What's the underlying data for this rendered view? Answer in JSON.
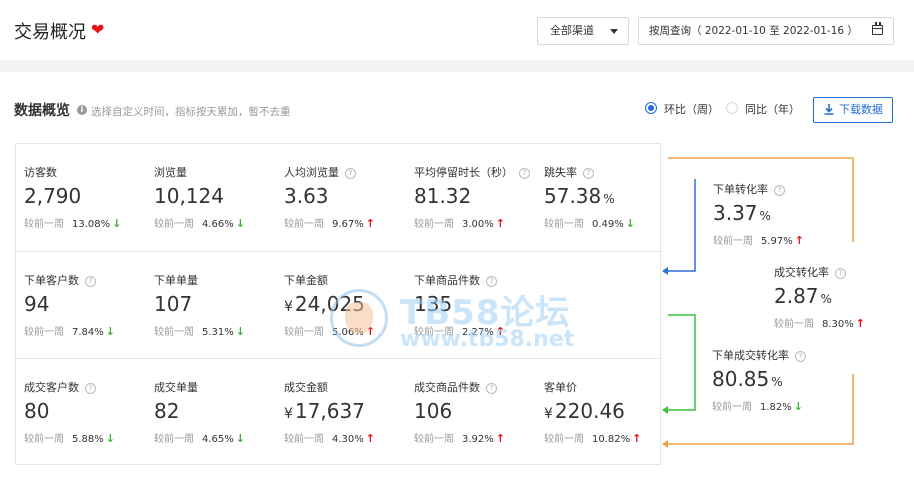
{
  "header": {
    "title": "交易概况",
    "channel": {
      "selected": "全部渠道"
    },
    "date_range": {
      "text": "按周查询（ 2022-01-10 至 2022-01-16 ）"
    }
  },
  "overview": {
    "title": "数据概览",
    "hint": "选择自定义时间，指标按天累加，暂不去重",
    "compare": {
      "options": [
        {
          "label": "环比（周）",
          "selected": true
        },
        {
          "label": "同比（年）",
          "selected": false
        }
      ]
    },
    "download_label": "下载数据",
    "compare_label": "较前一周",
    "rows": [
      [
        {
          "label": "访客数",
          "help": false,
          "prefix": "",
          "value": "2,790",
          "suffix": "",
          "rate": "13.08%",
          "trend": "down"
        },
        {
          "label": "浏览量",
          "help": false,
          "prefix": "",
          "value": "10,124",
          "suffix": "",
          "rate": "4.66%",
          "trend": "down"
        },
        {
          "label": "人均浏览量",
          "help": true,
          "prefix": "",
          "value": "3.63",
          "suffix": "",
          "rate": "9.67%",
          "trend": "up"
        },
        {
          "label": "平均停留时长（秒）",
          "help": true,
          "prefix": "",
          "value": "81.32",
          "suffix": "",
          "rate": "3.00%",
          "trend": "up"
        },
        {
          "label": "跳失率",
          "help": true,
          "prefix": "",
          "value": "57.38",
          "suffix": "%",
          "rate": "0.49%",
          "trend": "down"
        }
      ],
      [
        {
          "label": "下单客户数",
          "help": true,
          "prefix": "",
          "value": "94",
          "suffix": "",
          "rate": "7.84%",
          "trend": "down"
        },
        {
          "label": "下单单量",
          "help": false,
          "prefix": "",
          "value": "107",
          "suffix": "",
          "rate": "5.31%",
          "trend": "down"
        },
        {
          "label": "下单金额",
          "help": false,
          "prefix": "¥",
          "value": "24,025",
          "suffix": "",
          "rate": "5.06%",
          "trend": "up"
        },
        {
          "label": "下单商品件数",
          "help": true,
          "prefix": "",
          "value": "135",
          "suffix": "",
          "rate": "2.27%",
          "trend": "up"
        }
      ],
      [
        {
          "label": "成交客户数",
          "help": true,
          "prefix": "",
          "value": "80",
          "suffix": "",
          "rate": "5.88%",
          "trend": "down"
        },
        {
          "label": "成交单量",
          "help": false,
          "prefix": "",
          "value": "82",
          "suffix": "",
          "rate": "4.65%",
          "trend": "down"
        },
        {
          "label": "成交金额",
          "help": false,
          "prefix": "¥",
          "value": "17,637",
          "suffix": "",
          "rate": "4.30%",
          "trend": "up"
        },
        {
          "label": "成交商品件数",
          "help": true,
          "prefix": "",
          "value": "106",
          "suffix": "",
          "rate": "3.92%",
          "trend": "up"
        },
        {
          "label": "客单价",
          "help": false,
          "prefix": "¥",
          "value": "220.46",
          "suffix": "",
          "rate": "10.82%",
          "trend": "up"
        }
      ]
    ]
  },
  "conversion": [
    {
      "label": "下单转化率",
      "value": "3.37",
      "suffix": "%",
      "rate": "5.97%",
      "trend": "up"
    },
    {
      "label": "成交转化率",
      "value": "2.87",
      "suffix": "%",
      "rate": "8.30%",
      "trend": "up"
    },
    {
      "label": "下单成交转化率",
      "value": "80.85",
      "suffix": "%",
      "rate": "1.82%",
      "trend": "down"
    }
  ],
  "watermark": {
    "name": "TB58论坛",
    "url": "www.tb58.net"
  },
  "colors": {
    "accent": "#1f6fd1",
    "up": "#e4141b",
    "down": "#3cb034",
    "flow_orange": "#f0a143",
    "flow_blue": "#2f6fd9",
    "flow_green": "#3cc13b"
  },
  "icons": {
    "favorite": "heart-icon",
    "info": "info-icon",
    "help": "question-circle-icon",
    "calendar": "calendar-icon",
    "download": "download-icon",
    "dropdown": "caret-down-icon"
  }
}
